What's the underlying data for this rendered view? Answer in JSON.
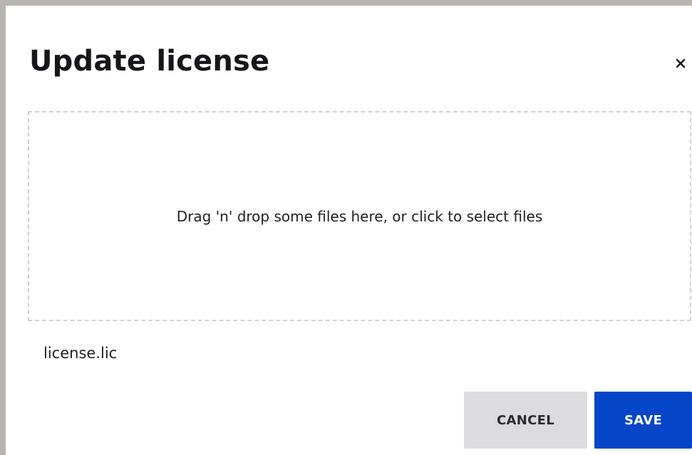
{
  "dialog": {
    "title": "Update license",
    "close_icon": "close-icon",
    "dropzone_text": "Drag 'n' drop some files here, or click to select files",
    "selected_file": "license.lic",
    "buttons": {
      "cancel_label": "CANCEL",
      "save_label": "SAVE"
    }
  },
  "colors": {
    "primary": "#0545c8",
    "secondary_button": "#dcdcdf",
    "dropzone_border": "#d2d2d2",
    "frame_border": "#b8b4b2"
  }
}
